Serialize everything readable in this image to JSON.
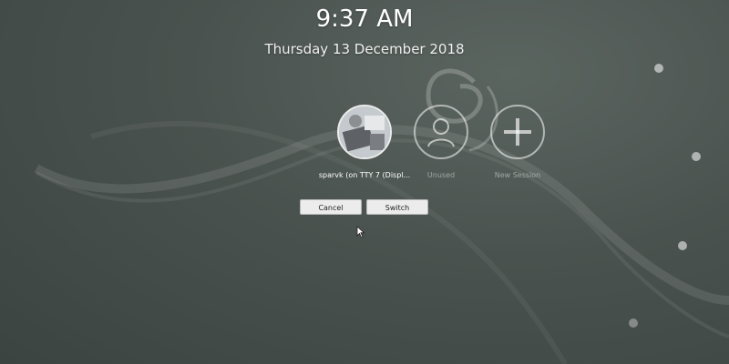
{
  "clock": {
    "time": "9:37 AM",
    "date": "Thursday 13 December 2018"
  },
  "sessions": [
    {
      "label": "sparvk (on TTY 7 (Displ...",
      "icon": "user-avatar-photo"
    },
    {
      "label": "Unused",
      "icon": "user-icon"
    },
    {
      "label": "New Session",
      "icon": "plus-icon"
    }
  ],
  "buttons": {
    "cancel": "Cancel",
    "switch": "Switch"
  },
  "colors": {
    "background": "#4a524f",
    "text": "#ffffff",
    "button": "#ececec"
  }
}
